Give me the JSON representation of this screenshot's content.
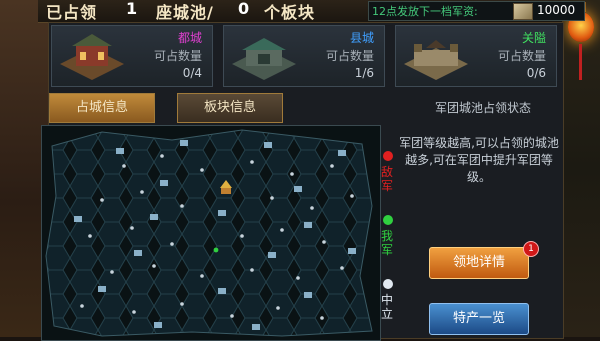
{
  "header": {
    "occupied_label": "已占领",
    "cities_count": "1",
    "cities_label": "座城池/",
    "blocks_count": "0",
    "blocks_label": "个板块",
    "reward_label": "12点发放下一档军资:",
    "reward_icon": "supply-scroll-icon",
    "reward_value": "10000"
  },
  "city_cards": [
    {
      "title": "都城",
      "title_color": "#e040d0",
      "label": "可占数量",
      "count": "0/4"
    },
    {
      "title": "县城",
      "title_color": "#40a0ff",
      "label": "可占数量",
      "count": "1/6"
    },
    {
      "title": "关隘",
      "title_color": "#40e060",
      "label": "可占数量",
      "count": "0/6"
    }
  ],
  "tabs": [
    {
      "label": "占城信息",
      "active": true
    },
    {
      "label": "板块信息",
      "active": false
    }
  ],
  "status_title": "军团城池占领状态",
  "legend": [
    {
      "label": "敌军",
      "color": "#e02020"
    },
    {
      "label": "我军",
      "color": "#30d040"
    },
    {
      "label": "中立",
      "color": "#e0e8f0"
    }
  ],
  "info_text": "军团等级越高,可以占领的城池越多,可在军团中提升军团等级。",
  "buttons": {
    "territory_details": "领地详情",
    "territory_badge": "1",
    "specialty_list": "特产一览"
  }
}
